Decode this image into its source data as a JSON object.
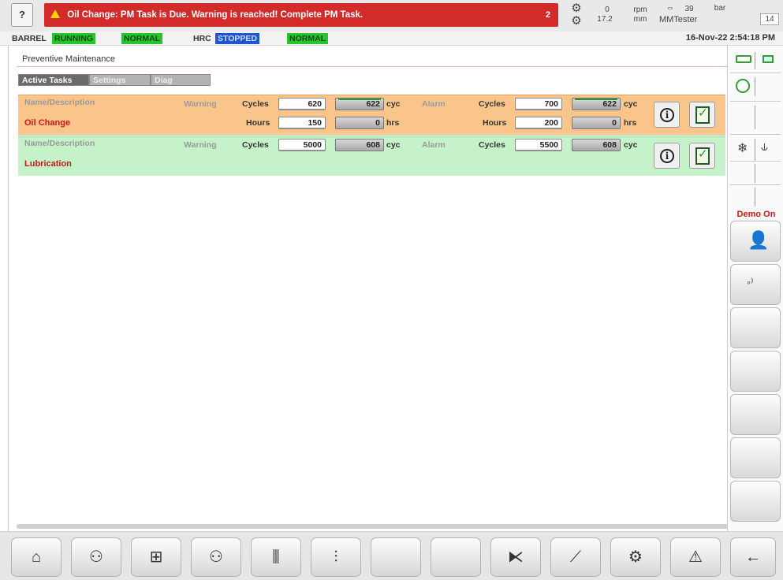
{
  "topbar": {
    "help_icon": "help-cursor-icon",
    "alarm_message": "Oil Change: PM Task is Due. Warning is reached! Complete PM Task.",
    "alarm_count": "2",
    "rpm_value": "0",
    "rpm_unit": "rpm",
    "mm_value": "17.2",
    "mm_unit": "mm",
    "pressure_value": "39",
    "pressure_unit": "bar",
    "user": "MMTester",
    "user_number": "14"
  },
  "status": {
    "barrel_label": "BARREL",
    "barrel_state": "RUNNING",
    "barrel_condition": "NORMAL",
    "hrc_label": "HRC",
    "hrc_state": "STOPPED",
    "hrc_condition": "NORMAL",
    "datetime": "16-Nov-22 2:54:18 PM",
    "colors": {
      "running": "#27c42e",
      "stopped": "#1f55d4",
      "alarm": "#d32a2a"
    }
  },
  "page": {
    "title": "Preventive Maintenance",
    "tabs": [
      "Active Tasks",
      "Settings",
      "Diag"
    ]
  },
  "tasks": [
    {
      "header_label": "Name/Description",
      "name": "Oil Change",
      "warning_label": "Warning",
      "alarm_label": "Alarm",
      "cycles_label": "Cycles",
      "hours_label": "Hours",
      "warning_cycles": "620",
      "warning_cycles_actual": "622",
      "warning_hours": "150",
      "warning_hours_actual": "0",
      "alarm_cycles": "700",
      "alarm_cycles_actual": "622",
      "alarm_hours": "200",
      "alarm_hours_actual": "0",
      "cyc_unit": "cyc",
      "hrs_unit": "hrs",
      "row_color": "#f9c58a"
    },
    {
      "header_label": "Name/Description",
      "name": "Lubrication",
      "warning_label": "Warning",
      "alarm_label": "Alarm",
      "cycles_label": "Cycles",
      "warning_cycles": "5000",
      "warning_cycles_actual": "608",
      "alarm_cycles": "5500",
      "alarm_cycles_actual": "608",
      "cyc_unit": "cyc",
      "row_color": "#c6f2c9"
    }
  ],
  "sidebar": {
    "demo_label": "Demo On"
  },
  "bottom_nav": {
    "icons": [
      "home-icon",
      "injection-unit-icon",
      "barrel-heaters-icon",
      "screw-icon",
      "hot-runner-icon",
      "production-icon",
      "blank",
      "blank",
      "ejector-icon",
      "graph-icon",
      "settings-gears-icon",
      "alarm-triangle-icon",
      "back-arrow-icon"
    ]
  }
}
